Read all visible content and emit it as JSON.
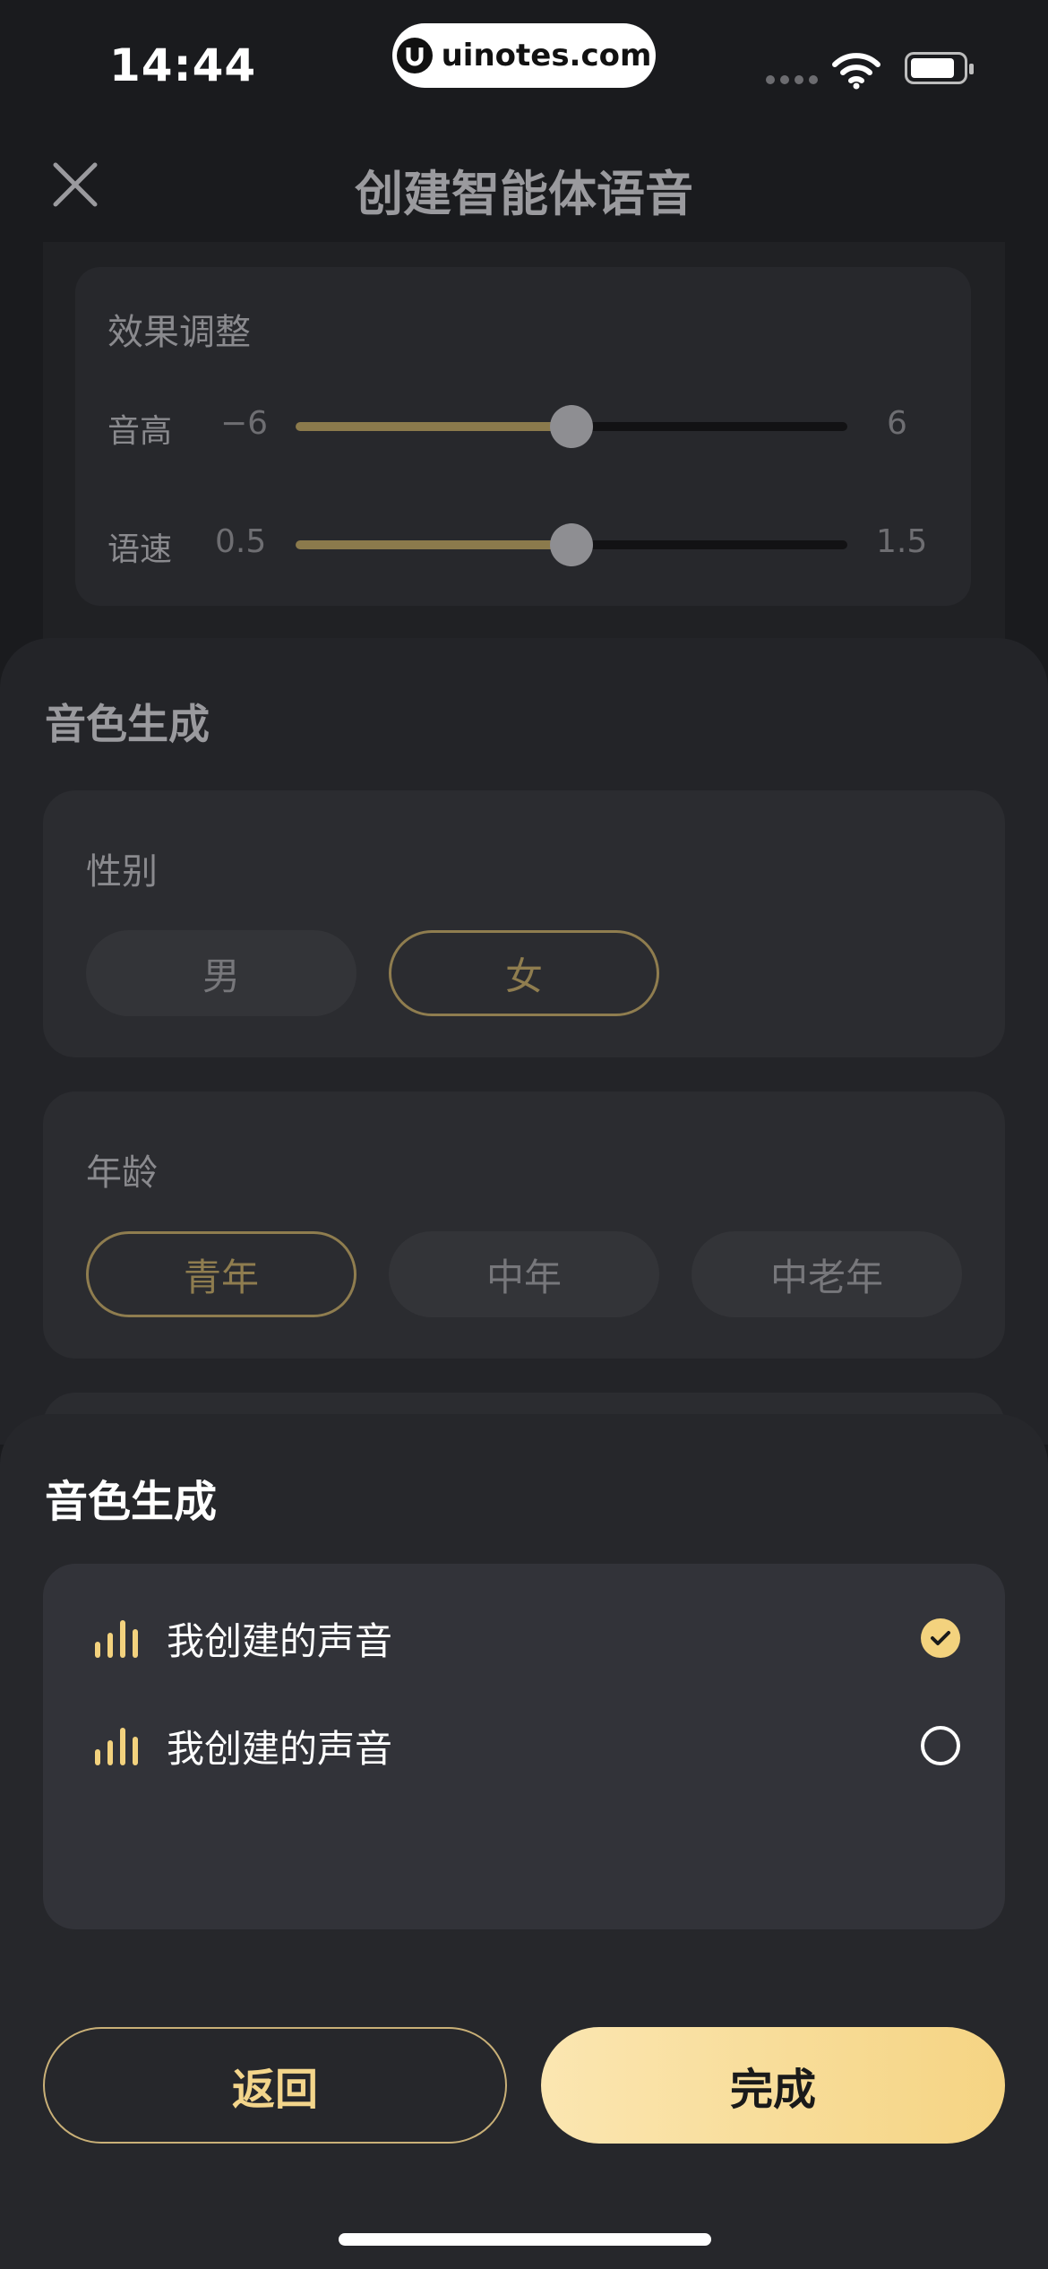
{
  "status": {
    "time": "14:44",
    "url": "uinotes.com"
  },
  "header": {
    "title": "创建智能体语音",
    "close_icon": "close-icon"
  },
  "effect": {
    "title": "效果调整",
    "pitch": {
      "label": "音高",
      "min": "−6",
      "max": "6",
      "value_fraction": 0.5
    },
    "speed": {
      "label": "语速",
      "min": "0.5",
      "max": "1.5",
      "value_fraction": 0.5
    }
  },
  "timbre_form": {
    "title": "音色生成",
    "gender": {
      "label": "性别",
      "options": [
        "男",
        "女"
      ],
      "selected": "女"
    },
    "age": {
      "label": "年龄",
      "options": [
        "青年",
        "中年",
        "中老年"
      ],
      "selected": "青年"
    }
  },
  "timbre_sheet": {
    "title": "音色生成",
    "items": [
      {
        "label": "我创建的声音",
        "checked": true
      },
      {
        "label": "我创建的声音",
        "checked": false
      }
    ],
    "back_label": "返回",
    "done_label": "完成"
  },
  "colors": {
    "accent": "#f3d27e",
    "sheet": "#26272b",
    "card": "#323339"
  }
}
